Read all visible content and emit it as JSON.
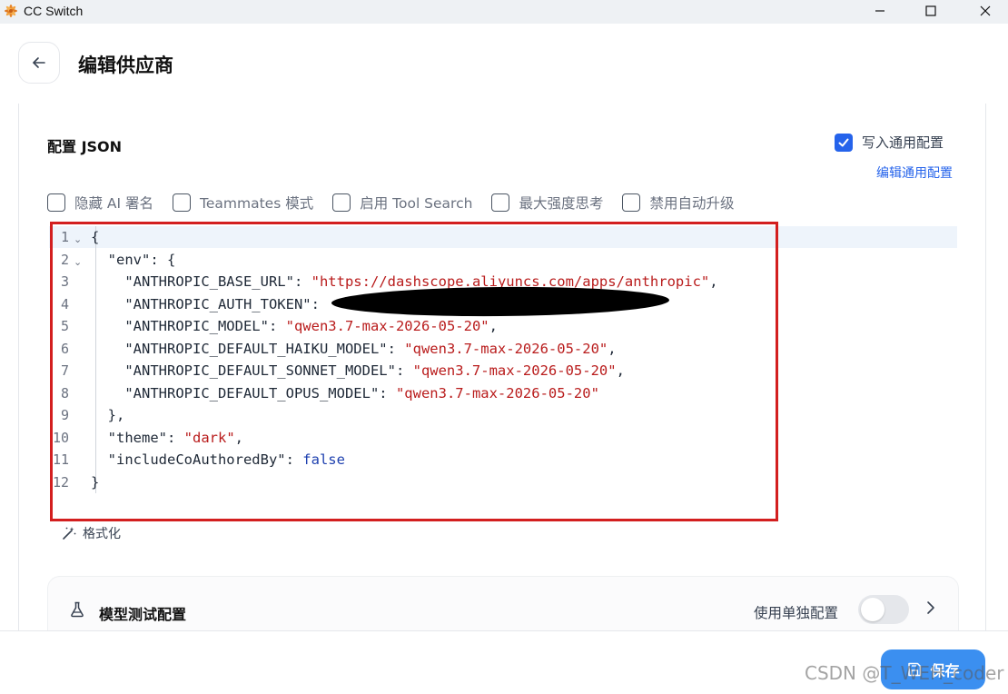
{
  "window": {
    "title": "CC Switch",
    "controls": {
      "minimize": "—",
      "maximize": "☐",
      "close": "✕"
    }
  },
  "header": {
    "title": "编辑供应商"
  },
  "config": {
    "section_label": "配置 JSON",
    "write_common": {
      "label": "写入通用配置",
      "checked": true
    },
    "edit_common_link": "编辑通用配置",
    "options": [
      {
        "label": "隐藏 AI 署名",
        "checked": false
      },
      {
        "label": "Teammates 模式",
        "checked": false
      },
      {
        "label": "启用 Tool Search",
        "checked": false
      },
      {
        "label": "最大强度思考",
        "checked": false
      },
      {
        "label": "禁用自动升级",
        "checked": false
      }
    ],
    "editor_lines": [
      {
        "n": "1",
        "fold": true,
        "tokens": [
          {
            "t": "{",
            "c": "p"
          }
        ]
      },
      {
        "n": "2",
        "fold": true,
        "tokens": [
          {
            "t": "  \"env\": {",
            "c": "p"
          }
        ]
      },
      {
        "n": "3",
        "tokens": [
          {
            "t": "    \"ANTHROPIC_BASE_URL\": ",
            "c": "p"
          },
          {
            "t": "\"https://dashscope.aliyuncs.com/apps/anthropic\"",
            "c": "s"
          },
          {
            "t": ",",
            "c": "p"
          }
        ]
      },
      {
        "n": "4",
        "tokens": [
          {
            "t": "    \"ANTHROPIC_AUTH_TOKEN\":",
            "c": "p"
          }
        ]
      },
      {
        "n": "5",
        "tokens": [
          {
            "t": "    \"ANTHROPIC_MODEL\": ",
            "c": "p"
          },
          {
            "t": "\"qwen3.7-max-2026-05-20\"",
            "c": "s"
          },
          {
            "t": ",",
            "c": "p"
          }
        ]
      },
      {
        "n": "6",
        "tokens": [
          {
            "t": "    \"ANTHROPIC_DEFAULT_HAIKU_MODEL\": ",
            "c": "p"
          },
          {
            "t": "\"qwen3.7-max-2026-05-20\"",
            "c": "s"
          },
          {
            "t": ",",
            "c": "p"
          }
        ]
      },
      {
        "n": "7",
        "tokens": [
          {
            "t": "    \"ANTHROPIC_DEFAULT_SONNET_MODEL\": ",
            "c": "p"
          },
          {
            "t": "\"qwen3.7-max-2026-05-20\"",
            "c": "s"
          },
          {
            "t": ",",
            "c": "p"
          }
        ]
      },
      {
        "n": "8",
        "tokens": [
          {
            "t": "    \"ANTHROPIC_DEFAULT_OPUS_MODEL\": ",
            "c": "p"
          },
          {
            "t": "\"qwen3.7-max-2026-05-20\"",
            "c": "s"
          }
        ]
      },
      {
        "n": "9",
        "tokens": [
          {
            "t": "  },",
            "c": "p"
          }
        ]
      },
      {
        "n": "10",
        "tokens": [
          {
            "t": "  \"theme\": ",
            "c": "p"
          },
          {
            "t": "\"dark\"",
            "c": "s"
          },
          {
            "t": ",",
            "c": "p"
          }
        ]
      },
      {
        "n": "11",
        "tokens": [
          {
            "t": "  \"includeCoAuthoredBy\": ",
            "c": "p"
          },
          {
            "t": "false",
            "c": "k"
          }
        ]
      },
      {
        "n": "12",
        "tokens": [
          {
            "t": "}",
            "c": "p"
          }
        ]
      }
    ],
    "format_button": "格式化"
  },
  "model_test": {
    "title": "模型测试配置",
    "use_single_label": "使用单独配置",
    "use_single_enabled": false
  },
  "footer": {
    "save_label": "保存",
    "watermark": "CSDN @T_WEH_coder"
  },
  "colors": {
    "accent": "#2563eb",
    "save_button": "#3b8ff0",
    "highlight_box": "#d31f1f",
    "json_string": "#b91c1c",
    "json_keyword": "#1e40af"
  }
}
